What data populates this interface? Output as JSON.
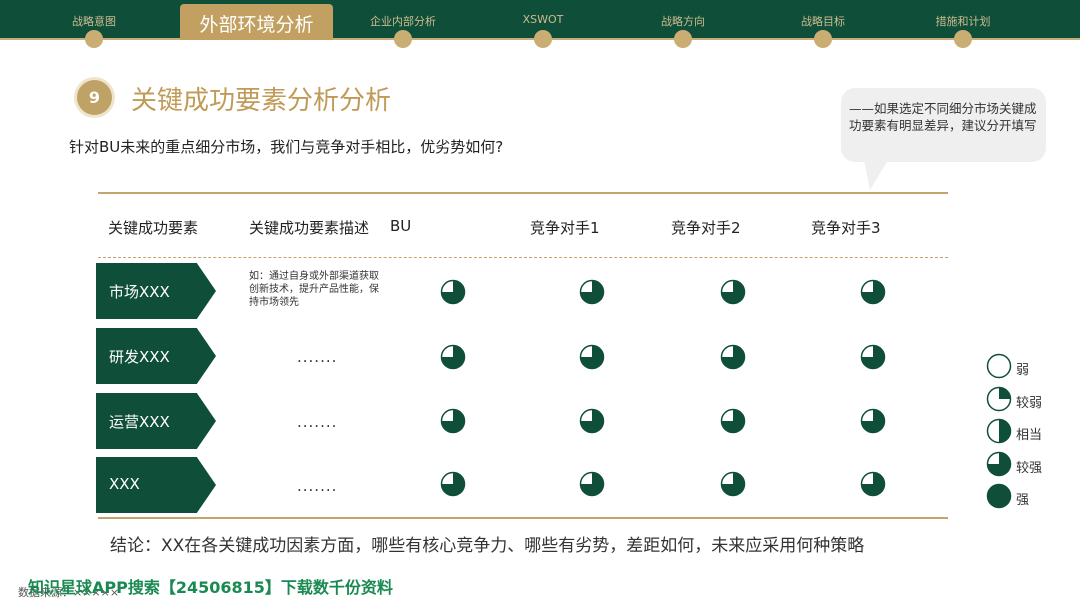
{
  "nav": {
    "items": [
      "战略意图",
      "外部环境分析",
      "企业内部分析",
      "XSWOT",
      "战略方向",
      "战略目标",
      "措施和计划"
    ],
    "active_index": 1
  },
  "section": {
    "number": "9",
    "title": "关键成功要素分析分析",
    "subtitle": "针对BU未来的重点细分市场，我们与竞争对手相比，优劣势如何?"
  },
  "callout": {
    "text": "——如果选定不同细分市场关键成功要素有明显差异，建议分开填写"
  },
  "table": {
    "headers": [
      "关键成功要素",
      "关键成功要素描述",
      "BU",
      "竞争对手1",
      "竞争对手2",
      "竞争对手3"
    ],
    "rows": [
      {
        "factor": "市场XXX",
        "description": "如：通过自身或外部渠道获取创新技术，提升产品性能，保持市场领先",
        "ratings": [
          0.75,
          0.75,
          0.75,
          0.75
        ]
      },
      {
        "factor": "研发XXX",
        "description": ".......",
        "ratings": [
          0.75,
          0.75,
          0.75,
          0.75
        ]
      },
      {
        "factor": "运营XXX",
        "description": ".......",
        "ratings": [
          0.75,
          0.75,
          0.75,
          0.75
        ]
      },
      {
        "factor": "XXX",
        "description": ".......",
        "ratings": [
          0.75,
          0.75,
          0.75,
          0.75
        ]
      }
    ]
  },
  "legend": [
    {
      "label": "弱",
      "level": 0
    },
    {
      "label": "较弱",
      "level": 0.25
    },
    {
      "label": "相当",
      "level": 0.5
    },
    {
      "label": "较强",
      "level": 0.75
    },
    {
      "label": "强",
      "level": 1
    }
  ],
  "conclusion": "结论：XX在各关键成功因素方面，哪些有核心竞争力、哪些有劣势，差距如何，未来应采用何种策略",
  "source": "数据来源：×××××",
  "watermark": "知识星球APP搜索【24506815】下载数千份资料",
  "colors": {
    "primary": "#0f4f3a",
    "gold": "#c2a061",
    "title": "#c09b57"
  }
}
